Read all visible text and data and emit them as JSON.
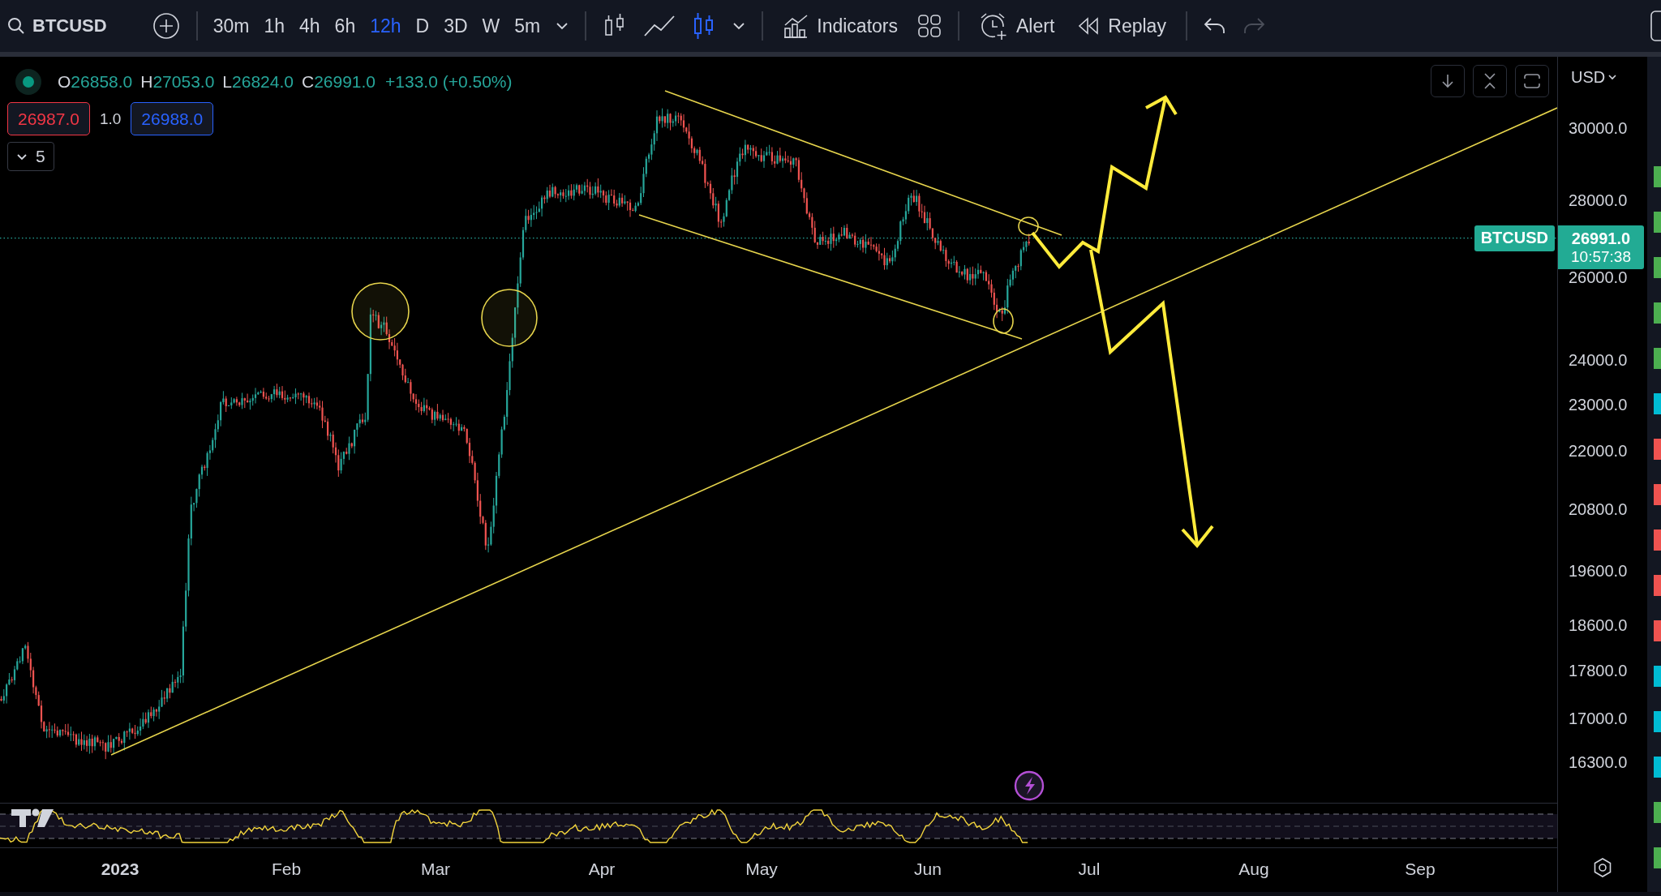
{
  "toolbar": {
    "symbol": "BTCUSD",
    "intervals": [
      {
        "label": "30m",
        "selected": false
      },
      {
        "label": "1h",
        "selected": false
      },
      {
        "label": "4h",
        "selected": false
      },
      {
        "label": "6h",
        "selected": false
      },
      {
        "label": "12h",
        "selected": true
      },
      {
        "label": "D",
        "selected": false
      },
      {
        "label": "3D",
        "selected": false
      },
      {
        "label": "W",
        "selected": false
      },
      {
        "label": "5m",
        "selected": false
      }
    ],
    "chart_types": [
      {
        "kind": "bars",
        "selected": false
      },
      {
        "kind": "line",
        "selected": false
      },
      {
        "kind": "candles",
        "selected": true
      }
    ],
    "indicators": "Indicators",
    "alert": "Alert",
    "replay": "Replay",
    "history": [
      {
        "kind": "undo",
        "disabled": false
      },
      {
        "kind": "redo",
        "disabled": true
      }
    ]
  },
  "legend": {
    "ohlc": [
      {
        "key": "O",
        "value": "26858.0"
      },
      {
        "key": "H",
        "value": "27053.0"
      },
      {
        "key": "L",
        "value": "26824.0"
      },
      {
        "key": "C",
        "value": "26991.0"
      }
    ],
    "change": "+133.0 (+0.50%)",
    "bid": "26987.0",
    "spread": "1.0",
    "ask": "26988.0",
    "collapsed_count": "5"
  },
  "price_axis": {
    "currency": "USD",
    "labels": [
      "30000.0",
      "28000.0",
      "26000.0",
      "24000.0",
      "23000.0",
      "22000.0",
      "20800.0",
      "19600.0",
      "18600.0",
      "17800.0",
      "17000.0",
      "16300.0"
    ],
    "symbol_tag": "BTCUSD",
    "last_price": "26991.0",
    "countdown": "10:57:38"
  },
  "time_axis": {
    "labels": [
      {
        "label": "2023",
        "kind": "year"
      },
      {
        "label": "Feb",
        "kind": "month"
      },
      {
        "label": "Mar",
        "kind": "month"
      },
      {
        "label": "Apr",
        "kind": "month"
      },
      {
        "label": "May",
        "kind": "month"
      },
      {
        "label": "Jun",
        "kind": "month"
      },
      {
        "label": "Jul",
        "kind": "month"
      },
      {
        "label": "Aug",
        "kind": "month"
      },
      {
        "label": "Sep",
        "kind": "month"
      }
    ]
  }
}
